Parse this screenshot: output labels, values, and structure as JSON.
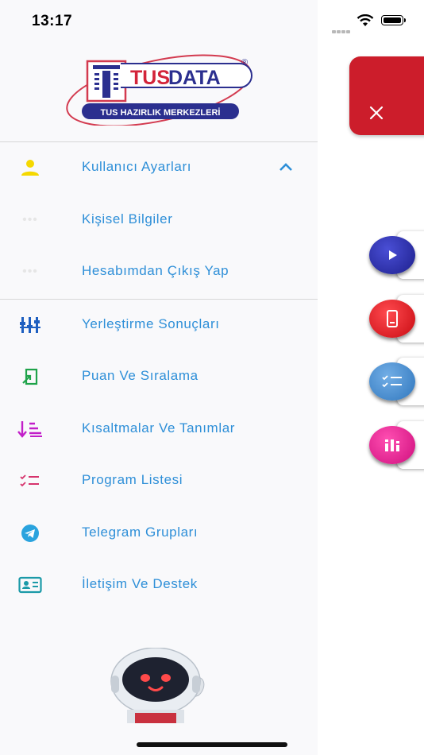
{
  "status_bar": {
    "time": "13:17"
  },
  "logo": {
    "brand_main": "TUS",
    "brand_sub": "DATA",
    "registered": "®",
    "tagline": "TUS HAZIRLIK MERKEZLERİ"
  },
  "menu": {
    "user_settings": "Kullanıcı Ayarları",
    "sub_items": [
      {
        "label": "Kişisel Bilgiler",
        "icon": "dots-icon"
      },
      {
        "label": "Hesabımdan Çıkış Yap",
        "icon": "dots-icon"
      }
    ],
    "items": [
      {
        "label": "Yerleştirme Sonuçları",
        "icon": "ranking-icon"
      },
      {
        "label": "Puan Ve Sıralama",
        "icon": "score-icon"
      },
      {
        "label": "Kısaltmalar Ve Tanımlar",
        "icon": "sort-icon"
      },
      {
        "label": "Program Listesi",
        "icon": "checklist-icon"
      },
      {
        "label": "Telegram Grupları",
        "icon": "telegram-icon"
      },
      {
        "label": "İletişim Ve Destek",
        "icon": "contact-card-icon"
      }
    ]
  },
  "colors": {
    "accent": "#2e8fd8",
    "close_panel": "#cc1d2b",
    "fab_video": "#2b2da3",
    "fab_mobile": "#e0141b",
    "fab_checklist": "#3e86cc",
    "fab_chart": "#e0148b"
  },
  "floating_buttons": [
    "play-icon",
    "mobile-icon",
    "checklist-icon",
    "chart-icon"
  ]
}
